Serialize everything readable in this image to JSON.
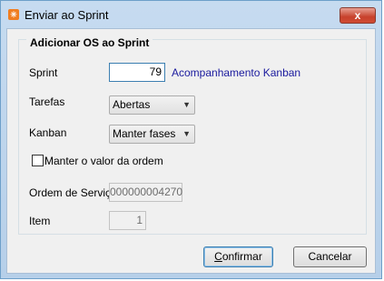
{
  "window": {
    "title": "Enviar ao Sprint",
    "close_symbol": "x"
  },
  "group": {
    "title": "Adicionar OS ao Sprint"
  },
  "fields": {
    "sprint": {
      "label": "Sprint",
      "value": "79",
      "description": "Acompanhamento Kanban"
    },
    "tarefas": {
      "label": "Tarefas",
      "selected": "Abertas"
    },
    "kanban": {
      "label": "Kanban",
      "selected": "Manter fases"
    },
    "keep_order": {
      "label": "Manter o valor da ordem",
      "checked": false
    },
    "ordem_servico": {
      "label": "Ordem de Serviço",
      "value": "000000004270"
    },
    "item": {
      "label": "Item",
      "value": "1"
    }
  },
  "buttons": {
    "confirm": {
      "underlined": "C",
      "rest": "onfirmar"
    },
    "cancel": {
      "label": "Cancelar"
    }
  },
  "icons": {
    "app": "app-logo-icon",
    "dropdown": "chevron-down-icon"
  }
}
